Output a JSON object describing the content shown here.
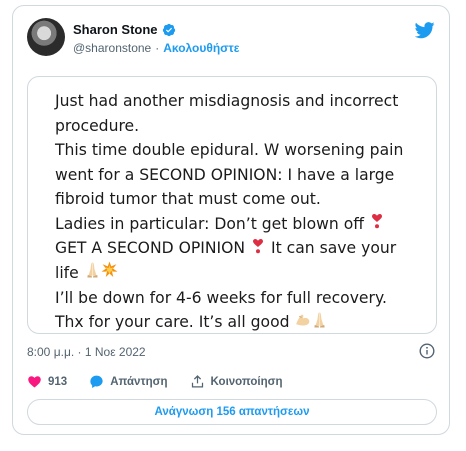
{
  "header": {
    "display_name": "Sharon Stone",
    "handle": "@sharonstone",
    "separator": "·",
    "follow_label": "Ακολουθήστε"
  },
  "tweet": {
    "lines": [
      "Just had another misdiagnosis and incorrect",
      "procedure.",
      "This time double epidural. W worsening pain",
      "went for a SECOND OPINION: I have a large",
      "fibroid tumor that must come out.",
      "Ladies in particular: Don’t get blown off ",
      "GET A SECOND OPINION ",
      " It can save your",
      "life ",
      "I’ll be down for 4-6 weeks for full recovery.",
      "Thx for your care. It’s all good "
    ],
    "emojis": {
      "exclamation": "❣️",
      "pray": "🙏🏻",
      "collision": "💥",
      "muscle": "💪🏻"
    }
  },
  "meta": {
    "time": "8:00 μ.μ.",
    "separator": "·",
    "date": "1 Νοε 2022"
  },
  "actions": {
    "likes_count": "913",
    "reply_label": "Απάντηση",
    "share_label": "Κοινοποίηση"
  },
  "read_replies_label": "Ανάγνωση 156 απαντήσεων",
  "colors": {
    "accent": "#1d9bf0",
    "like": "#f91880",
    "border": "#cfd9de"
  }
}
